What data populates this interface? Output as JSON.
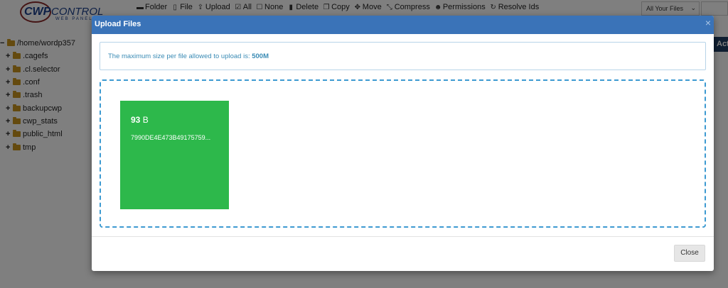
{
  "app": {
    "logo": {
      "brand": "CWP",
      "word": "CONTROL",
      "sub": "WEB PANEL"
    },
    "toolbar": [
      {
        "label": "Folder",
        "icon": "folder-icon",
        "glyph": "▬"
      },
      {
        "label": "File",
        "icon": "file-icon",
        "glyph": "▯"
      },
      {
        "label": "Upload",
        "icon": "upload-icon",
        "glyph": "⇪"
      },
      {
        "label": "All",
        "icon": "check-square-icon",
        "glyph": "☑"
      },
      {
        "label": "None",
        "icon": "square-icon",
        "glyph": "☐"
      },
      {
        "label": "Delete",
        "icon": "trash-icon",
        "glyph": "▮"
      },
      {
        "label": "Copy",
        "icon": "copy-icon",
        "glyph": "❐"
      },
      {
        "label": "Move",
        "icon": "move-icon",
        "glyph": "✥"
      },
      {
        "label": "Compress",
        "icon": "compress-icon",
        "glyph": "⤡"
      },
      {
        "label": "Permissions",
        "icon": "users-icon",
        "glyph": "☻"
      },
      {
        "label": "Resolve Ids",
        "icon": "refresh-icon",
        "glyph": "↻"
      }
    ],
    "filter": {
      "selected": "All Your Files"
    },
    "tree": {
      "root": "/home/wordp357",
      "children": [
        ".cagefs",
        ".cl.selector",
        ".conf",
        ".trash",
        "backupcwp",
        "cwp_stats",
        "public_html",
        "tmp"
      ]
    },
    "side_tab_label": "Act"
  },
  "modal": {
    "title": "Upload Files",
    "close_glyph": "×",
    "info_prefix": "The maximum size per file allowed to upload is: ",
    "info_max": "500M",
    "file": {
      "size_value": "93",
      "size_unit": "B",
      "name": "7990DE4E473B49175759..."
    },
    "close_button": "Close"
  },
  "colors": {
    "header": "#3a73b8",
    "file_card": "#2db84b",
    "dropzone_border": "#3d9ad1",
    "info_text": "#3a8bb5"
  }
}
